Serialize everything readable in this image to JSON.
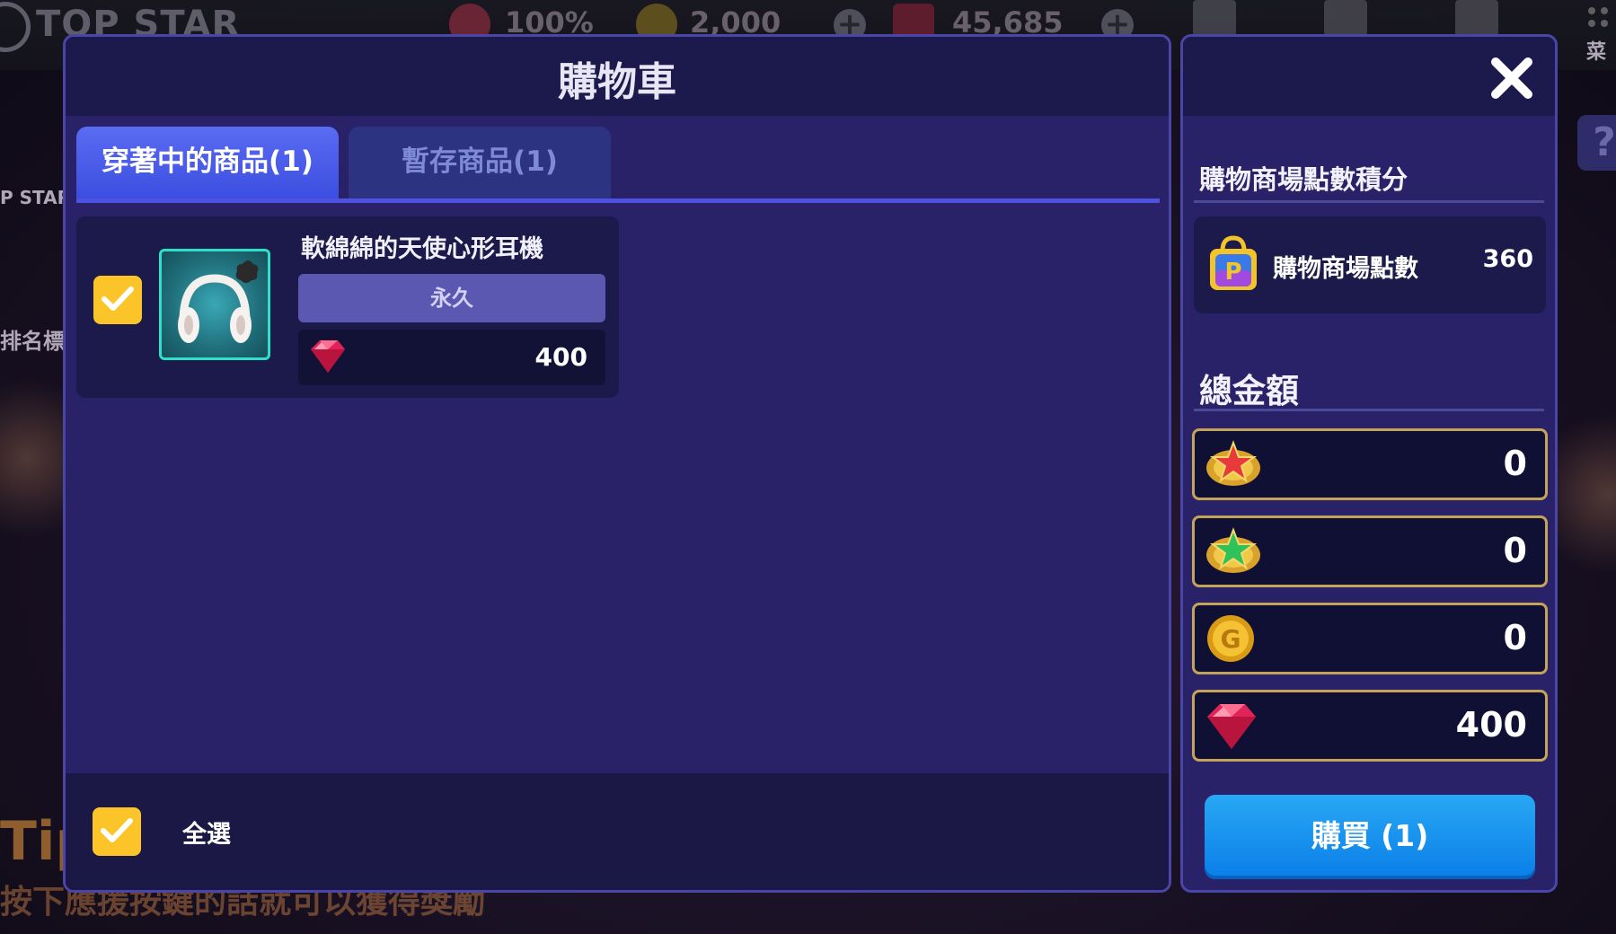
{
  "hud": {
    "title": "TOP STAR",
    "stamina": "100%",
    "gold": "2,000",
    "gems": "45,685",
    "menu_label": "菜"
  },
  "background": {
    "side_label_1": "P STAR",
    "side_label_2": "排名標",
    "tip_text": "Tip!",
    "tip_line": "按下應援按鍵的話就可以獲得獎勵"
  },
  "cart": {
    "title": "購物車",
    "tabs": [
      {
        "label": "穿著中的商品(1)",
        "active": true
      },
      {
        "label": "暫存商品(1)",
        "active": false
      }
    ],
    "items": [
      {
        "name": "軟綿綿的天使心形耳機",
        "duration": "永久",
        "price": "400",
        "checked": true,
        "icon": "headphones-icon",
        "currency_icon": "ruby-gem-icon"
      }
    ],
    "select_all_label": "全選"
  },
  "side": {
    "points_section_title": "購物商場點數積分",
    "points_label": "購物商場點數",
    "points_value": "360",
    "total_title": "總金額",
    "totals": [
      {
        "icon": "red-star-medal-icon",
        "value": "0"
      },
      {
        "icon": "green-star-medal-icon",
        "value": "0"
      },
      {
        "icon": "gold-coin-icon",
        "value": "0"
      },
      {
        "icon": "ruby-gem-icon",
        "value": "400"
      }
    ],
    "buy_label": "購買 (1)"
  },
  "colors": {
    "panel_bg": "#2a2268",
    "header_bg": "#1c1a4c",
    "active_tab": "#4a5ee8",
    "checkbox": "#fbc52a",
    "buy_button": "#1a94f0",
    "total_border": "#c4a45a"
  }
}
